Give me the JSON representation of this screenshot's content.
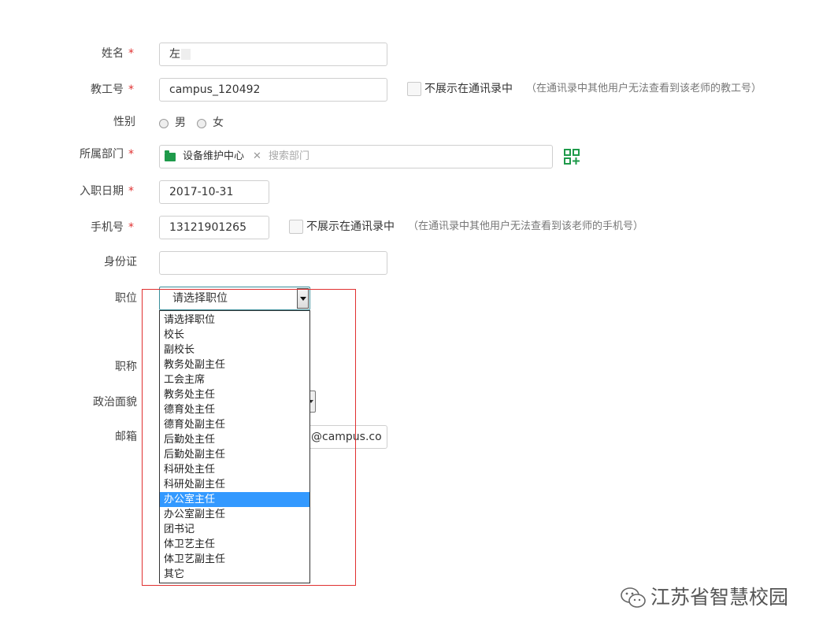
{
  "form": {
    "name": {
      "label": "姓名",
      "value": "左"
    },
    "staff_id": {
      "label": "教工号",
      "value": "campus_120492",
      "hide_label": "不展示在通讯录中",
      "hint": "（在通讯录中其他用户无法查看到该老师的教工号）"
    },
    "gender": {
      "label": "性别",
      "options": [
        "男",
        "女"
      ]
    },
    "department": {
      "label": "所属部门",
      "tag": "设备维护中心",
      "remove_glyph": "✕",
      "placeholder": "搜索部门"
    },
    "hire_date": {
      "label": "入职日期",
      "value": "2017-10-31"
    },
    "phone": {
      "label": "手机号",
      "value": "13121901265",
      "hide_label": "不展示在通讯录中",
      "hint": "（在通讯录中其他用户无法查看到该老师的手机号）"
    },
    "id_card": {
      "label": "身份证",
      "value": ""
    },
    "position": {
      "label": "职位",
      "selected": "请选择职位"
    },
    "title": {
      "label": "职称"
    },
    "political": {
      "label": "政治面貌"
    },
    "email": {
      "label": "邮箱",
      "suffix": "@campus.co"
    },
    "required_mark": "*"
  },
  "dropdown": {
    "options": [
      "请选择职位",
      "校长",
      "副校长",
      "教务处副主任",
      "工会主席",
      "教务处主任",
      "德育处主任",
      "德育处副主任",
      "后勤处主任",
      "后勤处副主任",
      "科研处主任",
      "科研处副主任",
      "办公室主任",
      "办公室副主任",
      "团书记",
      "体卫艺主任",
      "体卫艺副主任",
      "其它"
    ],
    "highlighted": "办公室主任"
  },
  "watermark": {
    "text": "江苏省智慧校园"
  },
  "colors": {
    "required": "#e03030",
    "accent": "#1e9a4a",
    "highlight": "#3399ff",
    "annotation": "#e03030"
  }
}
